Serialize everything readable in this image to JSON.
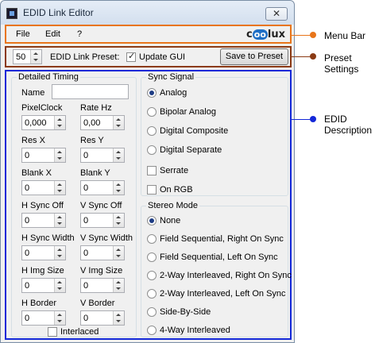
{
  "window": {
    "title": "EDID Link Editor",
    "close_label": "✕"
  },
  "menu": {
    "items": [
      "File",
      "Edit",
      "?"
    ],
    "logo_pre": "c",
    "logo_oo": "oo",
    "logo_post": "lux"
  },
  "preset": {
    "number": "50",
    "label": "EDID Link Preset:",
    "update_gui_label": "Update GUI",
    "update_gui_checked": true,
    "save_button": "Save to Preset"
  },
  "timing": {
    "title": "Detailed Timing",
    "name_label": "Name",
    "name_value": "",
    "fields": [
      {
        "label": "PixelClock",
        "value": "0,000"
      },
      {
        "label": "Rate Hz",
        "value": "0,00"
      },
      {
        "label": "Res X",
        "value": "0"
      },
      {
        "label": "Res Y",
        "value": "0"
      },
      {
        "label": "Blank X",
        "value": "0"
      },
      {
        "label": "Blank Y",
        "value": "0"
      },
      {
        "label": "H Sync Off",
        "value": "0"
      },
      {
        "label": "V Sync Off",
        "value": "0"
      },
      {
        "label": "H Sync Width",
        "value": "0"
      },
      {
        "label": "V Sync Width",
        "value": "0"
      },
      {
        "label": "H Img Size",
        "value": "0"
      },
      {
        "label": "V Img Size",
        "value": "0"
      },
      {
        "label": "H Border",
        "value": "0"
      },
      {
        "label": "V Border",
        "value": "0"
      }
    ],
    "interlaced_label": "Interlaced"
  },
  "sync": {
    "title": "Sync Signal",
    "options": [
      "Analog",
      "Bipolar Analog",
      "Digital Composite",
      "Digital Separate"
    ],
    "selected": "Analog",
    "serrate_label": "Serrate",
    "on_rgb_label": "On RGB"
  },
  "stereo": {
    "title": "Stereo Mode",
    "options": [
      "None",
      "Field Sequential, Right On Sync",
      "Field Sequential, Left On Sync",
      "2-Way Interleaved, Right On Sync",
      "2-Way Interleaved, Left On Sync",
      "Side-By-Side",
      "4-Way Interleaved"
    ],
    "selected": "None"
  },
  "callouts": {
    "menu_bar": "Menu Bar",
    "preset_settings_1": "Preset",
    "preset_settings_2": "Settings",
    "edid_1": "EDID",
    "edid_2": "Description"
  },
  "colors": {
    "menu_outline": "#e8751a",
    "preset_outline": "#8b3a14",
    "edid_outline": "#1428d8"
  }
}
